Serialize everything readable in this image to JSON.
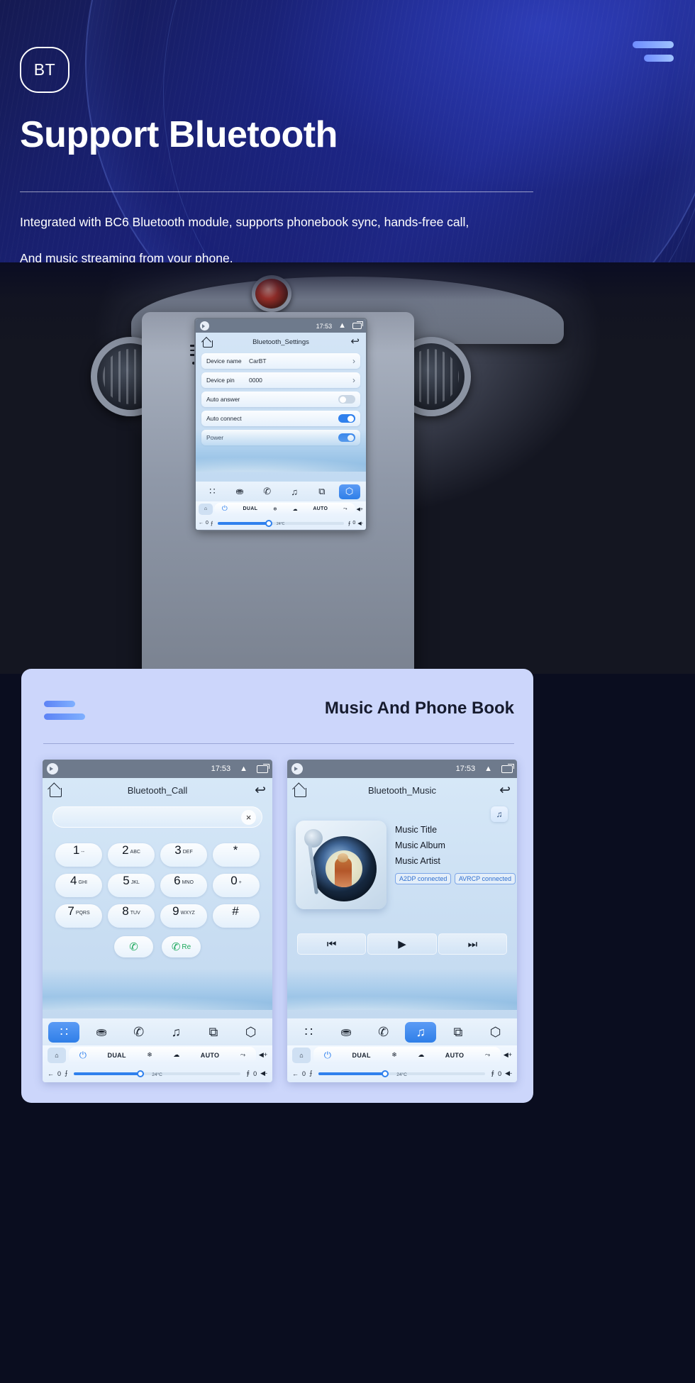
{
  "hero": {
    "badge": "BT",
    "title": "Support Bluetooth",
    "subtitle_line1": "Integrated with BC6 Bluetooth module, supports phonebook sync, hands-free call,",
    "subtitle_line2": "And music streaming from your phone.",
    "accent": "#6f8dff",
    "background": "#1b2480"
  },
  "headunit": {
    "statusbar": {
      "time": "17:53"
    },
    "app_title": "Bluetooth_Settings",
    "rows": [
      {
        "label": "Device name",
        "value": "CarBT",
        "control": "arrow"
      },
      {
        "label": "Device pin",
        "value": "0000",
        "control": "arrow"
      },
      {
        "label": "Auto answer",
        "value": "",
        "control": "toggle-off"
      },
      {
        "label": "Auto connect",
        "value": "",
        "control": "toggle-on"
      },
      {
        "label": "Power",
        "value": "",
        "control": "toggle-on"
      }
    ],
    "dock": [
      {
        "icon": "apps-grid-icon",
        "glyph": "∷",
        "active": false
      },
      {
        "icon": "contact-person-icon",
        "glyph": "⛂",
        "active": false
      },
      {
        "icon": "phone-handset-icon",
        "glyph": "✆",
        "active": false
      },
      {
        "icon": "music-note-icon",
        "glyph": "♫",
        "active": false
      },
      {
        "icon": "link-chain-icon",
        "glyph": "⧉",
        "active": false
      },
      {
        "icon": "settings-gear-icon",
        "glyph": "⬡",
        "active": true
      }
    ],
    "climate": {
      "home": "⌂",
      "power": "⏻",
      "dual": "DUAL",
      "snow": "❄",
      "defrost": "☁",
      "auto": "AUTO",
      "rear": "⤳",
      "vol_up": "◀+",
      "vol_down": "◀-",
      "back": "←",
      "left_value": "0",
      "right_value": "0",
      "temp": "24°C",
      "seat_left": "⨍",
      "seat_right": "⨎"
    }
  },
  "card": {
    "title": "Music And Phone Book",
    "accent": "#5d82f5",
    "background": "#ccd6fb"
  },
  "call_screen": {
    "statusbar": {
      "time": "17:53"
    },
    "app_title": "Bluetooth_Call",
    "input_value": "",
    "clear_label": "×",
    "keys": [
      {
        "digit": "1",
        "letters": "--"
      },
      {
        "digit": "2",
        "letters": "ABC"
      },
      {
        "digit": "3",
        "letters": "DEF"
      },
      {
        "digit": "*",
        "letters": ""
      },
      {
        "digit": "4",
        "letters": "GHI"
      },
      {
        "digit": "5",
        "letters": "JKL"
      },
      {
        "digit": "6",
        "letters": "MNO"
      },
      {
        "digit": "0",
        "letters": "+"
      },
      {
        "digit": "7",
        "letters": "PQRS"
      },
      {
        "digit": "8",
        "letters": "TUV"
      },
      {
        "digit": "9",
        "letters": "WXYZ"
      },
      {
        "digit": "#",
        "letters": ""
      }
    ],
    "call_button": "✆",
    "redial_button_icon": "✆",
    "redial_button_label": "Re",
    "dock_active_index": 0
  },
  "music_screen": {
    "statusbar": {
      "time": "17:53"
    },
    "app_title": "Bluetooth_Music",
    "fab_icon": "♫",
    "title_line": "Music Title",
    "album_line": "Music Album",
    "artist_line": "Music Artist",
    "badges": [
      "A2DP  connected",
      "AVRCP connected"
    ],
    "transport": [
      {
        "name": "previous-track-button",
        "glyph": "⏮"
      },
      {
        "name": "play-button",
        "glyph": "▶"
      },
      {
        "name": "next-track-button",
        "glyph": "⏭"
      }
    ],
    "dock_active_index": 3
  }
}
